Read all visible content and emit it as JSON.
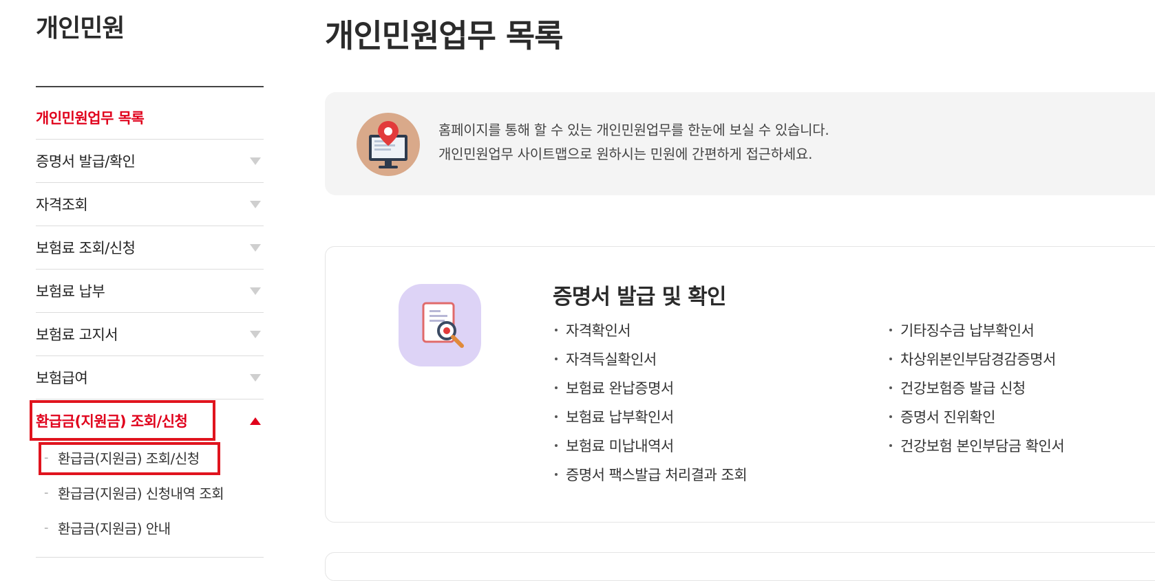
{
  "sidebar": {
    "title": "개인민원",
    "items": [
      {
        "label": "개인민원업무 목록"
      },
      {
        "label": "증명서 발급/확인"
      },
      {
        "label": "자격조회"
      },
      {
        "label": "보험료 조회/신청"
      },
      {
        "label": "보험료 납부"
      },
      {
        "label": "보험료 고지서"
      },
      {
        "label": "보험급여"
      },
      {
        "label": "환급금(지원금) 조회/신청"
      }
    ],
    "submenu": [
      {
        "label": "환급금(지원금) 조회/신청"
      },
      {
        "label": "환급금(지원금) 신청내역 조회"
      },
      {
        "label": "환급금(지원금) 안내"
      }
    ]
  },
  "main": {
    "title": "개인민원업무 목록",
    "intro": {
      "line1": "홈페이지를 통해 할 수 있는 개인민원업무를 한눈에 보실 수 있습니다.",
      "line2": "개인민원업무 사이트맵으로 원하시는 민원에 간편하게 접근하세요."
    },
    "card": {
      "title": "증명서 발급 및 확인",
      "col1": [
        "자격확인서",
        "자격득실확인서",
        "보험료 완납증명서",
        "보험료 납부확인서",
        "보험료 미납내역서",
        "증명서 팩스발급 처리결과 조회"
      ],
      "col2": [
        "기타징수금 납부확인서",
        "차상위본인부담경감증명서",
        "건강보험증 발급 신청",
        "증명서 진위확인",
        "건강보험 본인부담금 확인서"
      ]
    }
  },
  "colors": {
    "accent": "#e0001b",
    "highlight": "#e0141e"
  }
}
